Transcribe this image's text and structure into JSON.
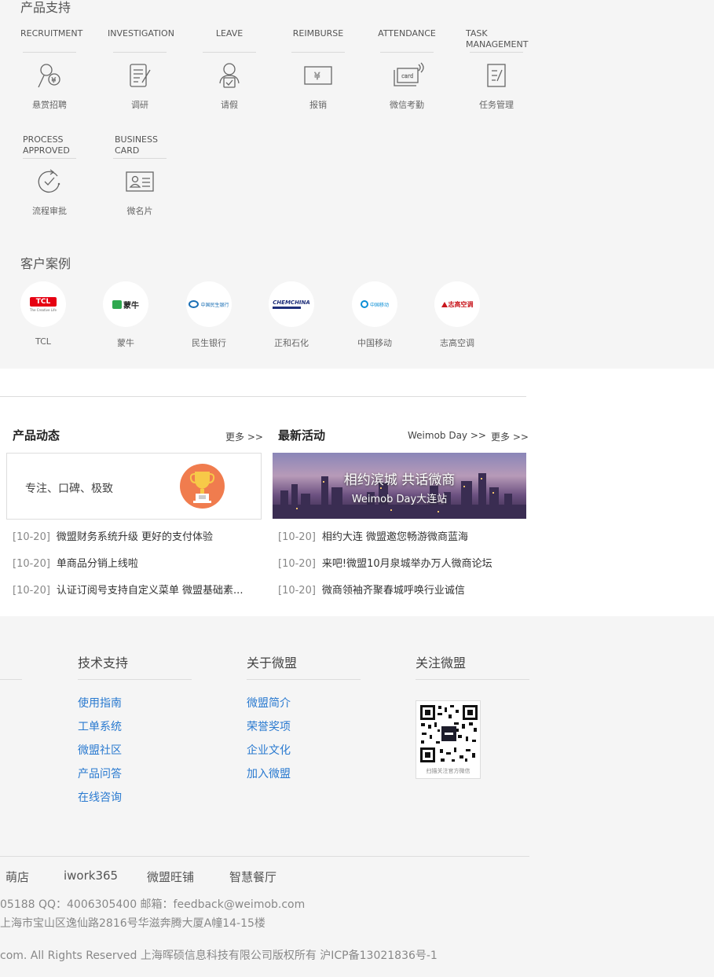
{
  "product_support": {
    "title": "产品支持",
    "modules": [
      {
        "en": "RECRUITMENT",
        "cn": "悬赏招聘",
        "icon": "money-person-icon"
      },
      {
        "en": "INVESTIGATION",
        "cn": "调研",
        "icon": "survey-pen-icon"
      },
      {
        "en": "LEAVE",
        "cn": "请假",
        "icon": "user-check-icon"
      },
      {
        "en": "REIMBURSE",
        "cn": "报销",
        "icon": "yuan-ticket-icon"
      },
      {
        "en": "ATTENDANCE",
        "cn": "微信考勤",
        "icon": "card-swipe-icon"
      },
      {
        "en": "TASK MANAGEMENT",
        "cn": "任务管理",
        "icon": "task-doc-icon"
      },
      {
        "en": "PROCESS APPROVED",
        "cn": "流程审批",
        "icon": "process-check-icon"
      },
      {
        "en": "BUSINESS CARD",
        "cn": "微名片",
        "icon": "business-card-icon"
      }
    ]
  },
  "customers": {
    "title": "客户案例",
    "items": [
      {
        "name": "TCL",
        "logo": "TCL",
        "tagline": "The Creative Life",
        "color": "#e60012"
      },
      {
        "name": "蒙牛",
        "logo": "蒙牛",
        "color": "#2fa84f"
      },
      {
        "name": "民生银行",
        "logo": "中国民生银行",
        "color": "#1a6fb5"
      },
      {
        "name": "正和石化",
        "logo": "CHEMCHINA",
        "color": "#1f2f7a"
      },
      {
        "name": "中国移动",
        "logo": "中国移动",
        "color": "#0a8ed6"
      },
      {
        "name": "志高空调",
        "logo": "志高空调",
        "color": "#c8161d"
      }
    ]
  },
  "product_news": {
    "title": "产品动态",
    "more": "更多 >>",
    "banner_text": "专注、口碑、极致",
    "items": [
      {
        "date": "[10-20]",
        "text": "微盟财务系统升级  更好的支付体验"
      },
      {
        "date": "[10-20]",
        "text": "单商品分销上线啦"
      },
      {
        "date": "[10-20]",
        "text": "认证订阅号支持自定义菜单 微盟基础素..."
      }
    ]
  },
  "latest_events": {
    "title": "最新活动",
    "weimob_day": "Weimob Day >>",
    "more": "更多 >>",
    "banner_title": "相约滨城 共话微商",
    "banner_sub": "Weimob Day大连站",
    "items": [
      {
        "date": "[10-20]",
        "text": "相约大连 微盟邀您畅游微商蓝海"
      },
      {
        "date": "[10-20]",
        "text": "来吧!微盟10月泉城举办万人微商论坛"
      },
      {
        "date": "[10-20]",
        "text": "微商领袖齐聚春城呼唤行业诚信"
      }
    ]
  },
  "footer": {
    "tech_support": {
      "title": "技术支持",
      "links": [
        "使用指南",
        "工单系统",
        "微盟社区",
        "产品问答",
        "在线咨询"
      ]
    },
    "about": {
      "title": "关于微盟",
      "links": [
        "微盟简介",
        "荣誉奖项",
        "企业文化",
        "加入微盟"
      ]
    },
    "follow": {
      "title": "关注微盟",
      "qr_caption": "扫描关注官方微信"
    },
    "products": [
      "萌店",
      "iwork365",
      "微盟旺铺",
      "智慧餐厅"
    ],
    "contact": "05188   QQ：4006305400   邮箱：feedback@weimob.com",
    "address": "上海市宝山区逸仙路2816号华滋奔腾大厦A幢14-15楼",
    "copyright": "com. All Rights Reserved 上海晖硕信息科技有限公司版权所有 沪ICP备13021836号-1"
  },
  "colors": {
    "link": "#2a7ad0",
    "section_bg": "#f5f5f5",
    "trophy": "#f07c4e"
  }
}
